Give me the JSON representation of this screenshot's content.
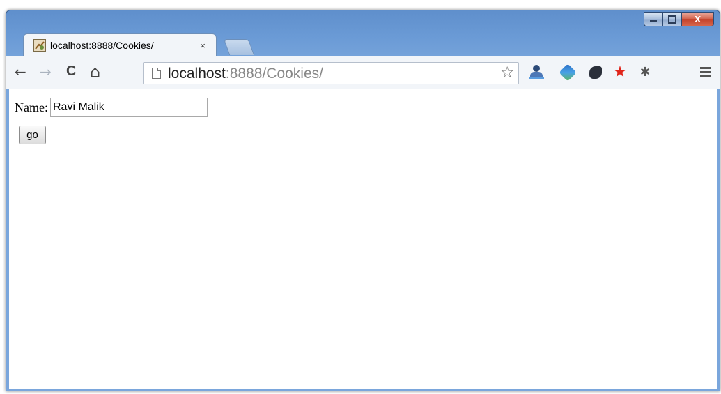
{
  "browser": {
    "tab": {
      "title": "localhost:8888/Cookies/",
      "close_glyph": "×",
      "favicon": "page-favicon"
    },
    "window_controls": {
      "close_glyph": "X"
    },
    "nav": {
      "back_glyph": "←",
      "forward_glyph": "→",
      "reload_glyph": "C",
      "home_glyph": "⌂"
    },
    "address": {
      "host": "localhost",
      "rest": ":8888/Cookies/"
    },
    "icons": {
      "bookmark_star": "☆",
      "ext_star": "★",
      "ext_puzzle": "✱"
    }
  },
  "page": {
    "form": {
      "name_label": "Name:",
      "name_value": "Ravi Malik",
      "go_label": "go"
    }
  },
  "colors": {
    "frame": "#6b9bd6",
    "close_button": "#c3412a",
    "url_host": "#222222",
    "url_rest": "#888888"
  }
}
